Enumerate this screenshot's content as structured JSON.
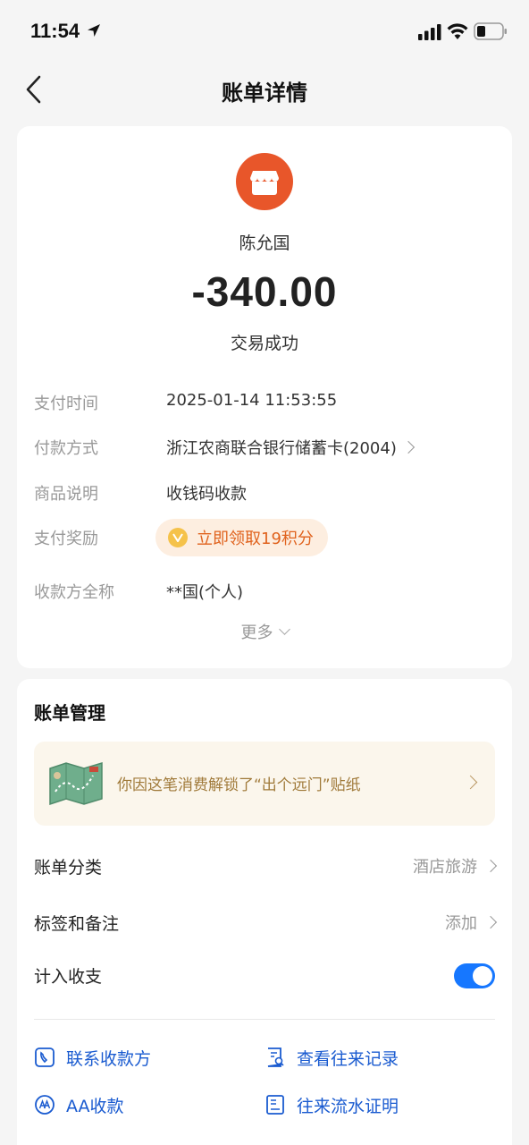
{
  "status_bar": {
    "time": "11:54"
  },
  "nav": {
    "title": "账单详情"
  },
  "bill": {
    "merchant_name": "陈允国",
    "amount": "-340.00",
    "status": "交易成功",
    "details": [
      {
        "label": "支付时间",
        "value": "2025-01-14 11:53:55"
      },
      {
        "label": "付款方式",
        "value": "浙江农商联合银行储蓄卡(2004)"
      },
      {
        "label": "商品说明",
        "value": "收钱码收款"
      },
      {
        "label": "支付奖励",
        "value": "立即领取19积分"
      },
      {
        "label": "收款方全称",
        "value": "**国(个人)"
      }
    ],
    "more_label": "更多"
  },
  "management": {
    "title": "账单管理",
    "sticker_text": "你因这笔消费解锁了“出个远门”贴纸",
    "rows": [
      {
        "label": "账单分类",
        "value": "酒店旅游"
      },
      {
        "label": "标签和备注",
        "value": "添加"
      },
      {
        "label": "计入收支",
        "value": ""
      }
    ],
    "toggle_on": true,
    "actions": [
      {
        "label": "联系收款方",
        "icon": "phone-icon"
      },
      {
        "label": "查看往来记录",
        "icon": "search-doc-icon"
      },
      {
        "label": "AA收款",
        "icon": "aa-icon"
      },
      {
        "label": "往来流水证明",
        "icon": "document-icon"
      }
    ]
  },
  "colors": {
    "accent": "#1677ff",
    "merchant_icon": "#e8562a",
    "reward": "#e0631e"
  }
}
